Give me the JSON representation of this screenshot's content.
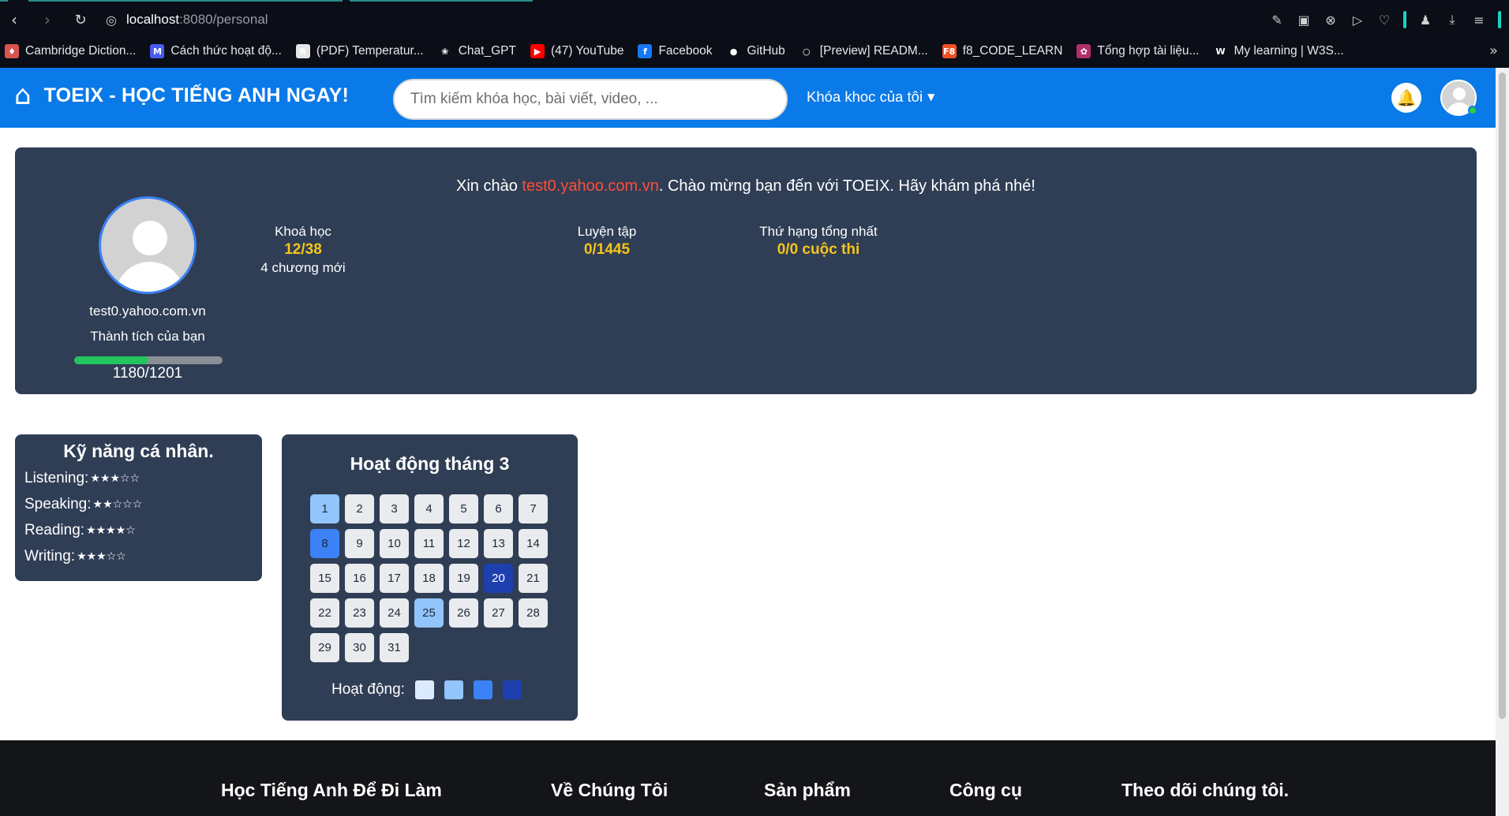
{
  "browser": {
    "url_host": "localhost",
    "url_path": ":8080/personal",
    "bookmarks": [
      {
        "label": "Cambridge Diction...",
        "icon": "cambridge-icon",
        "color": "#d9534f",
        "glyph": "♦"
      },
      {
        "label": "Cách thức hoạt độ...",
        "icon": "medium-m-icon",
        "color": "#4a5cf0",
        "glyph": "M"
      },
      {
        "label": "(PDF) Temperatur...",
        "icon": "researchgate-icon",
        "color": "#e6e6e6",
        "glyph": "R"
      },
      {
        "label": "Chat_GPT",
        "icon": "openai-icon",
        "color": "#0b0d17",
        "glyph": "❀"
      },
      {
        "label": "(47) YouTube",
        "icon": "youtube-icon",
        "color": "#ff0000",
        "glyph": "▶"
      },
      {
        "label": "Facebook",
        "icon": "facebook-icon",
        "color": "#1877f2",
        "glyph": "f"
      },
      {
        "label": "GitHub",
        "icon": "github-icon",
        "color": "#0b0d17",
        "glyph": "●"
      },
      {
        "label": "[Preview] READM...",
        "icon": "github-dim-icon",
        "color": "#0b0d17",
        "glyph": "○"
      },
      {
        "label": "f8_CODE_LEARN",
        "icon": "f8-icon",
        "color": "#f05123",
        "glyph": "F8"
      },
      {
        "label": "Tổng hợp tài liệu...",
        "icon": "flower-icon",
        "color": "#b0306a",
        "glyph": "✿"
      },
      {
        "label": "My learning | W3S...",
        "icon": "w3schools-icon",
        "color": "#0b0d17",
        "glyph": "W"
      }
    ]
  },
  "header": {
    "title": "TOEIX - HỌC TIẾNG ANH NGAY!",
    "search_placeholder": "Tìm kiếm khóa học, bài viết, video, ...",
    "courses_menu": "Khóa khoc của tôi"
  },
  "profile": {
    "welcome_prefix": "Xin chào ",
    "welcome_email": "test0.yahoo.com.vn",
    "welcome_suffix": ". Chào mừng bạn đến với TOEIX. Hãy khám phá nhé!",
    "email": "test0.yahoo.com.vn",
    "achievement_label": "Thành tích của bạn",
    "progress_text": "1180/1201",
    "progress_fraction": 0.5,
    "stats": [
      {
        "label": "Khoá học",
        "value": "12/38",
        "sub": "4 chương mới"
      },
      {
        "label": "Luyện tập",
        "value": "0/1445",
        "sub": ""
      },
      {
        "label": "Thứ hạng tổng nhất",
        "value": "0/0 cuộc thi",
        "sub": ""
      }
    ]
  },
  "skills": {
    "title": "Kỹ năng cá nhân.",
    "items": [
      {
        "label": "Listening:",
        "stars": "★★★☆☆",
        "rating": 3
      },
      {
        "label": "Speaking:",
        "stars": "★★☆☆☆",
        "rating": 2
      },
      {
        "label": "Reading:",
        "stars": "★★★★☆",
        "rating": 4
      },
      {
        "label": "Writing:",
        "stars": "★★★☆☆",
        "rating": 3
      }
    ]
  },
  "activity": {
    "title": "Hoạt động tháng 3",
    "days": [
      {
        "n": "1",
        "level": 1
      },
      {
        "n": "2",
        "level": 0
      },
      {
        "n": "3",
        "level": 0
      },
      {
        "n": "4",
        "level": 0
      },
      {
        "n": "5",
        "level": 0
      },
      {
        "n": "6",
        "level": 0
      },
      {
        "n": "7",
        "level": 0
      },
      {
        "n": "8",
        "level": 2
      },
      {
        "n": "9",
        "level": 0
      },
      {
        "n": "10",
        "level": 0
      },
      {
        "n": "11",
        "level": 0
      },
      {
        "n": "12",
        "level": 0
      },
      {
        "n": "13",
        "level": 0
      },
      {
        "n": "14",
        "level": 0
      },
      {
        "n": "15",
        "level": 0
      },
      {
        "n": "16",
        "level": 0
      },
      {
        "n": "17",
        "level": 0
      },
      {
        "n": "18",
        "level": 0
      },
      {
        "n": "19",
        "level": 0
      },
      {
        "n": "20",
        "level": 3
      },
      {
        "n": "21",
        "level": 0
      },
      {
        "n": "22",
        "level": 0
      },
      {
        "n": "23",
        "level": 0
      },
      {
        "n": "24",
        "level": 0
      },
      {
        "n": "25",
        "level": 1
      },
      {
        "n": "26",
        "level": 0
      },
      {
        "n": "27",
        "level": 0
      },
      {
        "n": "28",
        "level": 0
      },
      {
        "n": "29",
        "level": 0
      },
      {
        "n": "30",
        "level": 0
      },
      {
        "n": "31",
        "level": 0
      }
    ],
    "legend_label": "Hoạt động:",
    "legend_colors": [
      "#dbeafe",
      "#93c5fd",
      "#3b82f6",
      "#1e40af"
    ]
  },
  "footer": {
    "columns": [
      "Học Tiếng Anh Để Đi Làm",
      "Về Chúng Tôi",
      "Sản phẩm",
      "Công cụ",
      "Theo dõi chúng tôi."
    ]
  }
}
